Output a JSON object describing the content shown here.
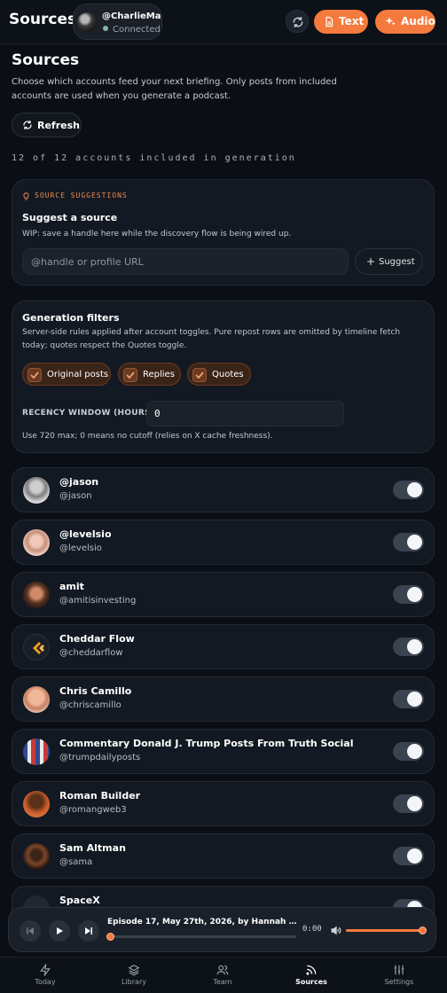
{
  "topbar": {
    "title": "Sources",
    "account_handle": "@CharlieMa...",
    "account_status": "Connected",
    "text_label": "Text",
    "audio_label": "Audio",
    "accent": "#f47a3d"
  },
  "page": {
    "title": "Sources",
    "description": "Choose which accounts feed your next briefing. Only posts from included accounts are used when you generate a podcast.",
    "refresh_label": "Refresh",
    "count_text": "12 of 12 accounts included in generation"
  },
  "suggestions": {
    "eyebrow": "SOURCE SUGGESTIONS",
    "title": "Suggest a source",
    "description": "WIP: save a handle here while the discovery flow is being wired up.",
    "input_placeholder": "@handle or profile URL",
    "button_label": "Suggest"
  },
  "filters": {
    "title": "Generation filters",
    "description": "Server-side rules applied after account toggles. Pure repost rows are omitted by timeline fetch today; quotes respect the Quotes toggle.",
    "chips": [
      {
        "label": "Original posts",
        "checked": true
      },
      {
        "label": "Replies",
        "checked": true
      },
      {
        "label": "Quotes",
        "checked": true
      }
    ],
    "recency_label": "RECENCY WINDOW (HOURS)",
    "recency_value": "0",
    "recency_help": "Use 720 max; 0 means no cutoff (relies on X cache freshness)."
  },
  "accounts": [
    {
      "name": "@jason",
      "handle": "@jason",
      "enabled": true
    },
    {
      "name": "@levelsio",
      "handle": "@levelsio",
      "enabled": true
    },
    {
      "name": "amit",
      "handle": "@amitisinvesting",
      "enabled": true
    },
    {
      "name": "Cheddar Flow",
      "handle": "@cheddarflow",
      "enabled": true
    },
    {
      "name": "Chris Camillo",
      "handle": "@chriscamillo",
      "enabled": true
    },
    {
      "name": "Commentary Donald J. Trump Posts From Truth Social",
      "handle": "@trumpdailyposts",
      "enabled": true
    },
    {
      "name": "Roman Builder",
      "handle": "@romangweb3",
      "enabled": true
    },
    {
      "name": "Sam Altman",
      "handle": "@sama",
      "enabled": true
    },
    {
      "name": "SpaceX",
      "handle": "",
      "enabled": true
    }
  ],
  "player": {
    "episode_title": "Episode 17, May 27th, 2026, by Hannah Female ...",
    "time": "0:00",
    "progress": 0,
    "volume": 1
  },
  "nav": {
    "items": [
      {
        "label": "Today",
        "icon": "bolt-icon"
      },
      {
        "label": "Library",
        "icon": "layers-icon"
      },
      {
        "label": "Team",
        "icon": "users-icon"
      },
      {
        "label": "Sources",
        "icon": "rss-icon",
        "active": true
      },
      {
        "label": "Settings",
        "icon": "sliders-icon"
      }
    ]
  }
}
